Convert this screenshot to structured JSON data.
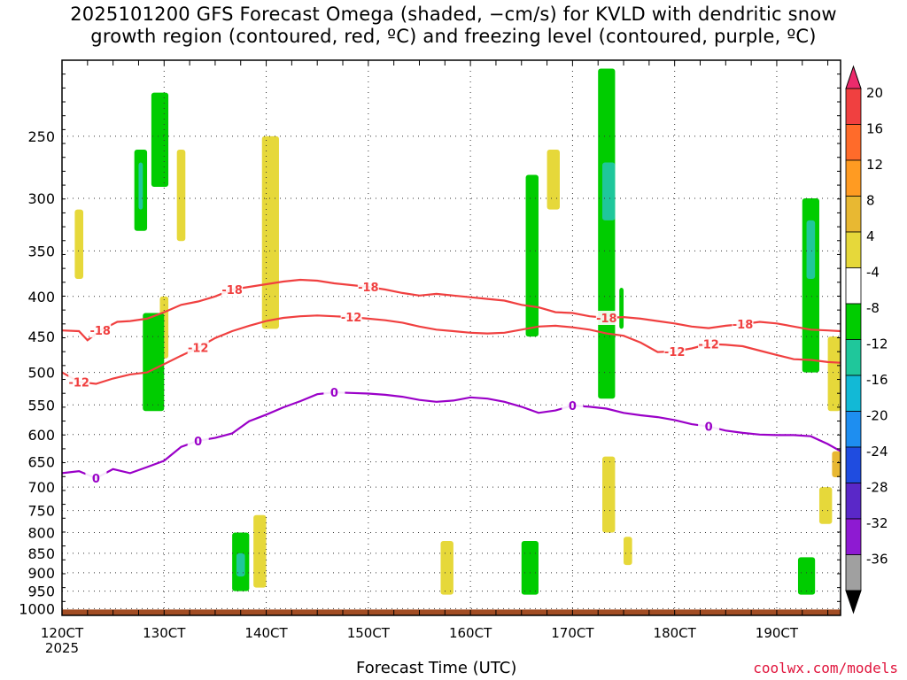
{
  "title_line1": "2025101200 GFS Forecast Omega (shaded, −cm/s) for KVLD with dendritic snow",
  "title_line2": "growth region (contoured, red, ºC) and freezing level (contoured, purple, ºC)",
  "xlabel": "Forecast Time (UTC)",
  "credit": "coolwx.com/models",
  "chart_data": {
    "type": "heatmap",
    "title": "2025101200 GFS Forecast Omega (shaded, −cm/s) for KVLD with dendritic snow growth region (contoured, red, ºC) and freezing level (contoured, purple, ºC)",
    "xlabel": "Forecast Time (UTC)",
    "ylabel": "",
    "x_ticks": [
      "120CT",
      "130CT",
      "140CT",
      "150CT",
      "160CT",
      "170CT",
      "180CT",
      "190CT"
    ],
    "x_tick_year": "2025",
    "x_range_hours": [
      0,
      183
    ],
    "y_ticks": [
      250,
      300,
      350,
      400,
      450,
      500,
      550,
      600,
      650,
      700,
      750,
      800,
      850,
      900,
      950,
      1000
    ],
    "y_range_hPa": [
      200,
      1020
    ],
    "y_scale": "log",
    "grid": true,
    "colorbar": {
      "labels": [
        "20",
        "16",
        "12",
        "8",
        "4",
        "-4",
        "-8",
        "-12",
        "-16",
        "-20",
        "-24",
        "-28",
        "-32",
        "-36"
      ],
      "colors": [
        "#ec2b6c",
        "#f04040",
        "#ff6b2a",
        "#ff9b22",
        "#e8b832",
        "#e6d83a",
        "#ffffff",
        "#00cc00",
        "#1fc79b",
        "#12b9d6",
        "#1e8ef0",
        "#1f4ce0",
        "#5a28c8",
        "#8e1ad2",
        "#a0a0a0",
        "#000000"
      ]
    },
    "contours": [
      {
        "level": -18,
        "color": "#f04040",
        "name": "-18",
        "points": [
          [
            0,
            442
          ],
          [
            4,
            443
          ],
          [
            6,
            455
          ],
          [
            9,
            442
          ],
          [
            13,
            431
          ],
          [
            16,
            430
          ],
          [
            20,
            427
          ],
          [
            24,
            419
          ],
          [
            28,
            410
          ],
          [
            32,
            406
          ],
          [
            36,
            400
          ],
          [
            40,
            392
          ],
          [
            44,
            389
          ],
          [
            48,
            386
          ],
          [
            52,
            383
          ],
          [
            56,
            381
          ],
          [
            60,
            382
          ],
          [
            64,
            385
          ],
          [
            68,
            387
          ],
          [
            72,
            389
          ],
          [
            76,
            392
          ],
          [
            80,
            396
          ],
          [
            84,
            399
          ],
          [
            88,
            397
          ],
          [
            92,
            399
          ],
          [
            96,
            401
          ],
          [
            100,
            403
          ],
          [
            104,
            405
          ],
          [
            108,
            410
          ],
          [
            112,
            413
          ],
          [
            116,
            419
          ],
          [
            120,
            420
          ],
          [
            124,
            424
          ],
          [
            128,
            426
          ],
          [
            132,
            425
          ],
          [
            136,
            427
          ],
          [
            140,
            430
          ],
          [
            144,
            433
          ],
          [
            148,
            437
          ],
          [
            152,
            439
          ],
          [
            156,
            436
          ],
          [
            160,
            434
          ],
          [
            164,
            431
          ],
          [
            168,
            433
          ],
          [
            172,
            437
          ],
          [
            176,
            441
          ],
          [
            180,
            442
          ],
          [
            183,
            443
          ]
        ]
      },
      {
        "level": -12,
        "color": "#f04040",
        "name": "-12",
        "points": [
          [
            0,
            500
          ],
          [
            4,
            514
          ],
          [
            8,
            517
          ],
          [
            12,
            509
          ],
          [
            16,
            503
          ],
          [
            20,
            500
          ],
          [
            24,
            488
          ],
          [
            28,
            476
          ],
          [
            32,
            465
          ],
          [
            36,
            452
          ],
          [
            40,
            443
          ],
          [
            44,
            436
          ],
          [
            48,
            430
          ],
          [
            52,
            426
          ],
          [
            56,
            424
          ],
          [
            60,
            423
          ],
          [
            64,
            424
          ],
          [
            68,
            425
          ],
          [
            72,
            427
          ],
          [
            76,
            429
          ],
          [
            80,
            432
          ],
          [
            84,
            437
          ],
          [
            88,
            441
          ],
          [
            92,
            443
          ],
          [
            96,
            445
          ],
          [
            100,
            446
          ],
          [
            104,
            445
          ],
          [
            108,
            441
          ],
          [
            112,
            437
          ],
          [
            116,
            436
          ],
          [
            120,
            438
          ],
          [
            124,
            441
          ],
          [
            128,
            446
          ],
          [
            132,
            449
          ],
          [
            136,
            458
          ],
          [
            140,
            471
          ],
          [
            144,
            470
          ],
          [
            148,
            466
          ],
          [
            152,
            460
          ],
          [
            156,
            461
          ],
          [
            160,
            463
          ],
          [
            164,
            469
          ],
          [
            168,
            475
          ],
          [
            172,
            481
          ],
          [
            176,
            482
          ],
          [
            180,
            485
          ],
          [
            183,
            486
          ]
        ]
      },
      {
        "level": 0,
        "color": "#9a00c8",
        "name": "0",
        "points": [
          [
            0,
            672
          ],
          [
            4,
            668
          ],
          [
            8,
            682
          ],
          [
            12,
            664
          ],
          [
            16,
            672
          ],
          [
            20,
            660
          ],
          [
            24,
            648
          ],
          [
            28,
            622
          ],
          [
            32,
            611
          ],
          [
            36,
            606
          ],
          [
            40,
            598
          ],
          [
            44,
            577
          ],
          [
            48,
            566
          ],
          [
            52,
            554
          ],
          [
            56,
            544
          ],
          [
            60,
            533
          ],
          [
            64,
            530
          ],
          [
            68,
            531
          ],
          [
            72,
            532
          ],
          [
            76,
            534
          ],
          [
            80,
            537
          ],
          [
            84,
            542
          ],
          [
            88,
            545
          ],
          [
            92,
            543
          ],
          [
            96,
            538
          ],
          [
            100,
            540
          ],
          [
            104,
            545
          ],
          [
            108,
            553
          ],
          [
            112,
            563
          ],
          [
            116,
            559
          ],
          [
            120,
            551
          ],
          [
            124,
            553
          ],
          [
            128,
            556
          ],
          [
            132,
            563
          ],
          [
            136,
            567
          ],
          [
            140,
            570
          ],
          [
            144,
            575
          ],
          [
            148,
            582
          ],
          [
            152,
            586
          ],
          [
            156,
            593
          ],
          [
            160,
            597
          ],
          [
            164,
            600
          ],
          [
            168,
            601
          ],
          [
            172,
            601
          ],
          [
            176,
            603
          ],
          [
            180,
            617
          ],
          [
            183,
            630
          ]
        ]
      }
    ],
    "omega_blobs": [
      {
        "x": [
          3,
          5
        ],
        "p": [
          310,
          380
        ],
        "value": 5
      },
      {
        "x": [
          17,
          20
        ],
        "p": [
          260,
          330
        ],
        "value": -7
      },
      {
        "x": [
          18,
          19
        ],
        "p": [
          270,
          310
        ],
        "value": -10
      },
      {
        "x": [
          21,
          25
        ],
        "p": [
          220,
          290
        ],
        "value": -6
      },
      {
        "x": [
          23,
          25
        ],
        "p": [
          400,
          480
        ],
        "value": 5
      },
      {
        "x": [
          27,
          29
        ],
        "p": [
          260,
          340
        ],
        "value": 5
      },
      {
        "x": [
          19,
          24
        ],
        "p": [
          420,
          560
        ],
        "value": -6
      },
      {
        "x": [
          40,
          44
        ],
        "p": [
          800,
          950
        ],
        "value": -8
      },
      {
        "x": [
          41,
          43
        ],
        "p": [
          850,
          910
        ],
        "value": -12
      },
      {
        "x": [
          47,
          51
        ],
        "p": [
          250,
          440
        ],
        "value": 5
      },
      {
        "x": [
          45,
          48
        ],
        "p": [
          760,
          940
        ],
        "value": 5
      },
      {
        "x": [
          89,
          92
        ],
        "p": [
          820,
          960
        ],
        "value": 5
      },
      {
        "x": [
          109,
          112
        ],
        "p": [
          280,
          450
        ],
        "value": -6
      },
      {
        "x": [
          108,
          112
        ],
        "p": [
          820,
          960
        ],
        "value": -7
      },
      {
        "x": [
          114,
          117
        ],
        "p": [
          260,
          310
        ],
        "value": 5
      },
      {
        "x": [
          126,
          130
        ],
        "p": [
          205,
          540
        ],
        "value": -6
      },
      {
        "x": [
          127,
          130
        ],
        "p": [
          270,
          320
        ],
        "value": -10
      },
      {
        "x": [
          127,
          130
        ],
        "p": [
          640,
          800
        ],
        "value": 5
      },
      {
        "x": [
          131,
          132
        ],
        "p": [
          390,
          440
        ],
        "value": -6
      },
      {
        "x": [
          132,
          134
        ],
        "p": [
          810,
          880
        ],
        "value": 5
      },
      {
        "x": [
          174,
          178
        ],
        "p": [
          300,
          500
        ],
        "value": -6
      },
      {
        "x": [
          175,
          177
        ],
        "p": [
          320,
          380
        ],
        "value": -10
      },
      {
        "x": [
          180,
          183
        ],
        "p": [
          450,
          560
        ],
        "value": 5
      },
      {
        "x": [
          178,
          181
        ],
        "p": [
          700,
          780
        ],
        "value": 5
      },
      {
        "x": [
          173,
          177
        ],
        "p": [
          860,
          960
        ],
        "value": -7
      },
      {
        "x": [
          181,
          183
        ],
        "p": [
          630,
          680
        ],
        "value": 8
      }
    ],
    "terrain_color": "#a24d24"
  }
}
